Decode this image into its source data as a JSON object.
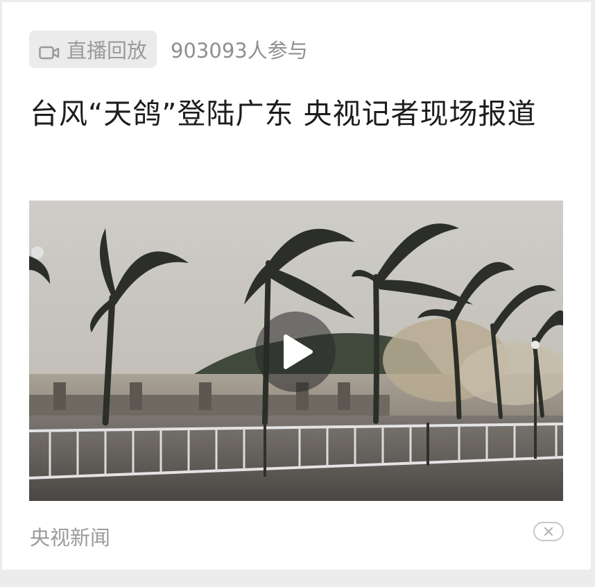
{
  "badge": {
    "icon": "video-camera-icon",
    "label": "直播回放"
  },
  "participants": "903093人参与",
  "headline": "台风“天鸽”登陆广东 央视记者现场报道",
  "video": {
    "play_icon": "play-icon"
  },
  "footer": {
    "source": "央视新闻",
    "close_icon": "close-icon"
  }
}
